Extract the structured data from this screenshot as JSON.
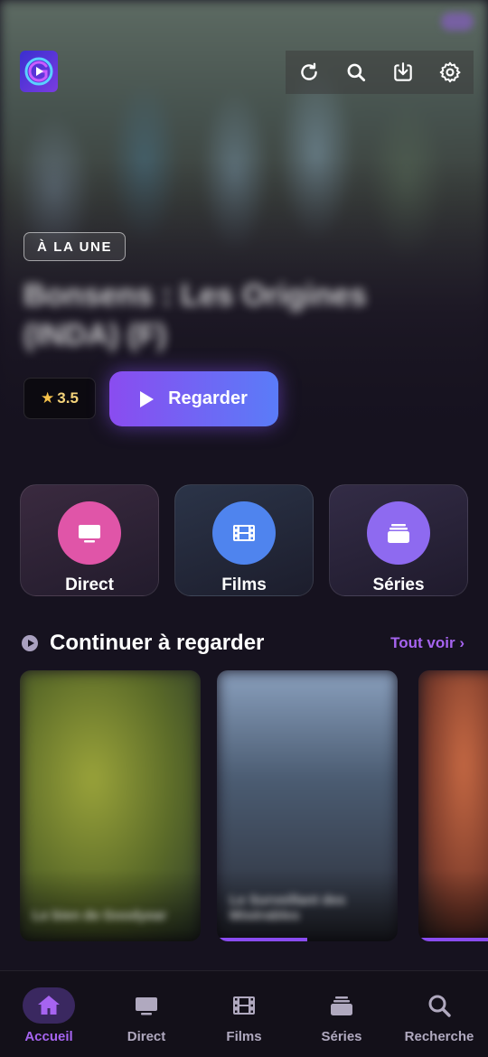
{
  "app": {
    "accent": "#8a4cf0",
    "background": "#16121f"
  },
  "header": {
    "logo_icon": "app-logo",
    "actions": [
      {
        "name": "refresh-icon"
      },
      {
        "name": "search-icon"
      },
      {
        "name": "download-icon"
      },
      {
        "name": "settings-icon"
      }
    ]
  },
  "featured": {
    "badge": "À LA UNE",
    "title": "Bonsens : Les Origines (INDA) (F)",
    "rating_value": "3.5",
    "star": "★",
    "play_label": "Regarder"
  },
  "categories": [
    {
      "label": "Direct",
      "icon": "tv-icon",
      "color": "#e055a8"
    },
    {
      "label": "Films",
      "icon": "film-icon",
      "color": "#4f84ee"
    },
    {
      "label": "Séries",
      "icon": "series-icon",
      "color": "#8e6af0"
    }
  ],
  "continue_section": {
    "title": "Continuer à regarder",
    "see_all": "Tout voir ›",
    "items": [
      {
        "title": "Le bien de Goodyear",
        "progress": 0
      },
      {
        "title": "Le Surveillant des Misérables",
        "progress": 0.5
      },
      {
        "title": "",
        "progress": 0.9
      }
    ]
  },
  "bottom_nav": {
    "items": [
      {
        "label": "Accueil",
        "icon": "home-icon",
        "active": true
      },
      {
        "label": "Direct",
        "icon": "tv-icon",
        "active": false
      },
      {
        "label": "Films",
        "icon": "film-icon",
        "active": false
      },
      {
        "label": "Séries",
        "icon": "series-icon",
        "active": false
      },
      {
        "label": "Recherche",
        "icon": "search-icon",
        "active": false
      }
    ]
  }
}
